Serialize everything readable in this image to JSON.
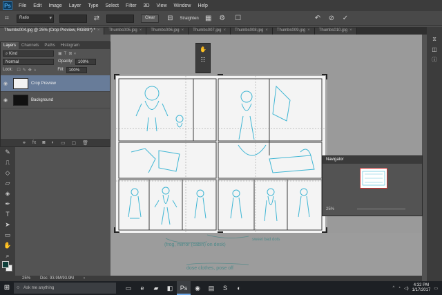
{
  "menubar": {
    "logo": "Ps",
    "items": [
      "File",
      "Edit",
      "Image",
      "Layer",
      "Type",
      "Select",
      "Filter",
      "3D",
      "View",
      "Window",
      "Help"
    ]
  },
  "options": {
    "ratio_label": "Ratio",
    "clear_label": "Clear",
    "straighten_label": "Straighten"
  },
  "tabs": [
    {
      "label": "Thumbs004.jpg @ 25% (Crop Preview, RGB/8*) *",
      "active": true
    },
    {
      "label": "Thumbs005.jpg",
      "active": false
    },
    {
      "label": "Thumbs006.jpg",
      "active": false
    },
    {
      "label": "Thumbs007.jpg",
      "active": false
    },
    {
      "label": "Thumbs008.jpg",
      "active": false
    },
    {
      "label": "Thumbs009.jpg",
      "active": false
    },
    {
      "label": "Thumbs010.jpg",
      "active": false
    }
  ],
  "layers_panel": {
    "tabs": [
      "Layers",
      "Channels",
      "Paths",
      "Histogram"
    ],
    "kind_label": "Kind",
    "blend_mode": "Normal",
    "opacity_label": "Opacity:",
    "opacity_value": "100%",
    "lock_label": "Lock:",
    "fill_label": "Fill:",
    "fill_value": "100%",
    "layers": [
      {
        "name": "Crop Preview",
        "selected": true
      },
      {
        "name": "Background",
        "selected": false
      }
    ]
  },
  "navigator": {
    "title": "Navigator",
    "zoom": "25%"
  },
  "status": {
    "zoom": "25%",
    "doc": "Doc: 93.9M/93.9M"
  },
  "taskbar": {
    "search_placeholder": "Ask me anything",
    "time": "4:32 PM",
    "date": "1/17/2017"
  },
  "colors": {
    "accent": "#687c99",
    "foreground_swatch": "#0f3e3a",
    "sketch_blue": "#3fb6d4"
  }
}
